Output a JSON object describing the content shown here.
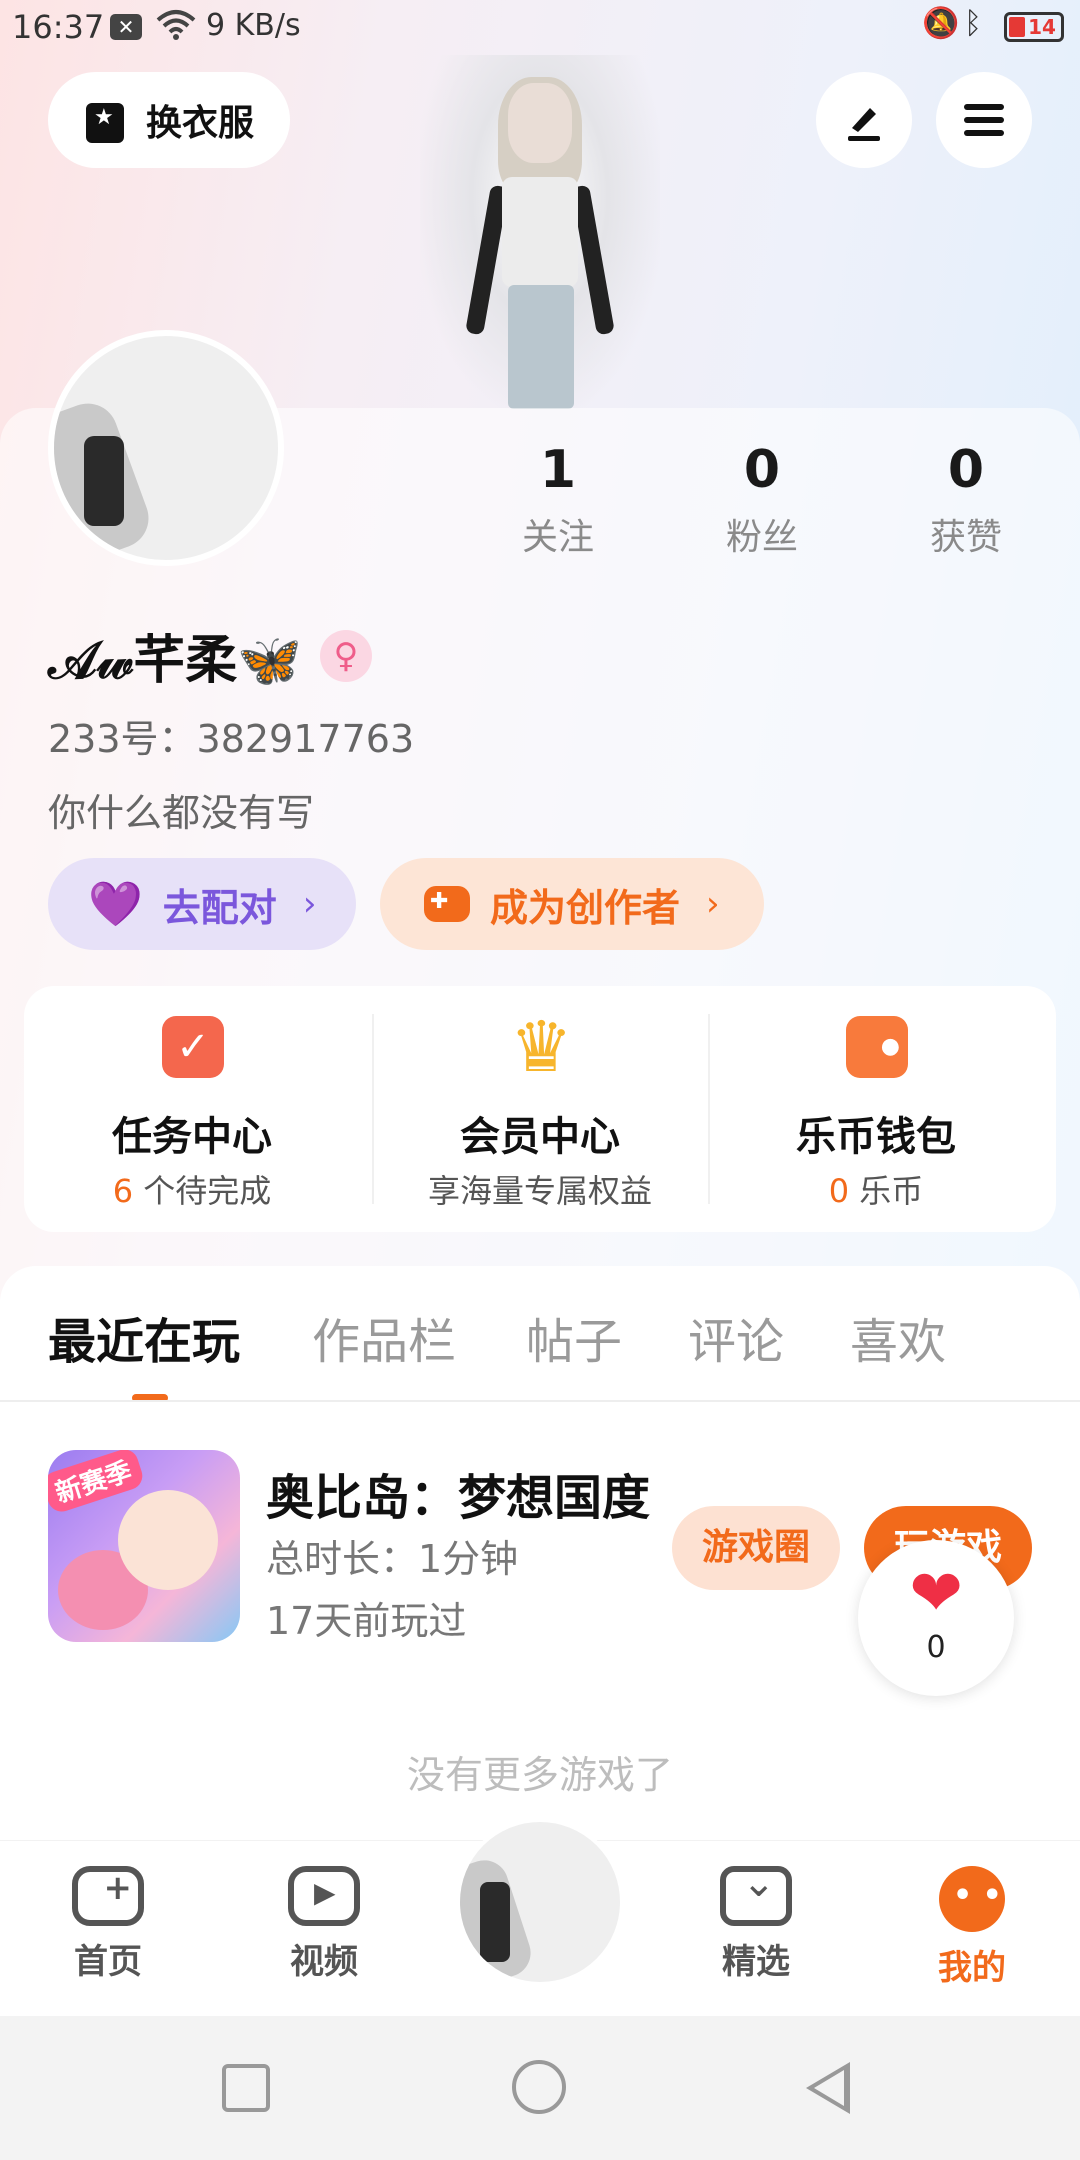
{
  "status_bar": {
    "time": "16:37",
    "speed": "9 KB/s",
    "battery": "14",
    "icons": [
      "notification-x-icon",
      "wifi-icon",
      "bell-muted-icon",
      "bluetooth-icon",
      "battery-icon"
    ]
  },
  "header": {
    "outfit_label": "换衣服",
    "edit_icon": "pen-icon",
    "menu_icon": "hamburger-icon"
  },
  "profile": {
    "stats": [
      {
        "value": "1",
        "label": "关注"
      },
      {
        "value": "0",
        "label": "粉丝"
      },
      {
        "value": "0",
        "label": "获赞"
      }
    ],
    "nickname": "𝒜𝓌芊柔🦋",
    "gender_symbol": "♀",
    "uid": "233号：382917763",
    "bio": "你什么都没有写",
    "match_label": "去配对",
    "creator_label": "成为创作者"
  },
  "services": [
    {
      "title": "任务中心",
      "sub_highlight": "6",
      "sub_text": " 个待完成"
    },
    {
      "title": "会员中心",
      "sub_highlight": "",
      "sub_text": "享海量专属权益"
    },
    {
      "title": "乐币钱包",
      "sub_highlight": "0",
      "sub_text": " 乐币"
    }
  ],
  "tabs": [
    {
      "label": "最近在玩"
    },
    {
      "label": "作品栏"
    },
    {
      "label": "帖子"
    },
    {
      "label": "评论"
    },
    {
      "label": "喜欢"
    }
  ],
  "game": {
    "thumb_badge": "新赛季",
    "title": "奥比岛：梦想国度",
    "duration": "总时长：1分钟",
    "last_played": "17天前玩过",
    "circle_button": "游戏圈",
    "play_button": "玩游戏",
    "like_count": "0"
  },
  "no_more_text": "没有更多游戏了",
  "bottom_nav": {
    "home": "首页",
    "video": "视频",
    "featured": "精选",
    "mine": "我的"
  },
  "colors": {
    "accent": "#f26a1b",
    "match_purple": "#7b57dc",
    "like_red": "#ef2f45"
  }
}
